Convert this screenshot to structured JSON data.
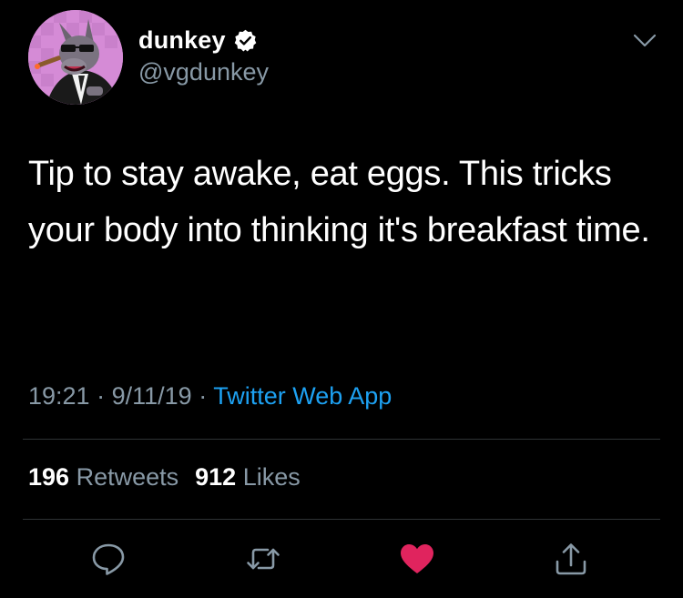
{
  "author": {
    "display_name": "dunkey",
    "handle": "@vgdunkey",
    "verified": true,
    "avatar_icon": "cartoon-avatar"
  },
  "tweet": {
    "text": "Tip to stay awake, eat eggs. This tricks your body into thinking it's breakfast time.",
    "time": "19:21",
    "date": "9/11/19",
    "separator": "·",
    "source": "Twitter Web App"
  },
  "stats": {
    "retweets_count": "196",
    "retweets_label": "Retweets",
    "likes_count": "912",
    "likes_label": "Likes"
  },
  "actions": [
    {
      "name": "reply",
      "icon": "reply-icon"
    },
    {
      "name": "retweet",
      "icon": "retweet-icon"
    },
    {
      "name": "like",
      "icon": "heart-icon",
      "active": true
    },
    {
      "name": "share",
      "icon": "share-icon"
    }
  ],
  "colors": {
    "background": "#000000",
    "text": "#ffffff",
    "secondary": "#8899a6",
    "link": "#1da1f2",
    "like": "#e0245e",
    "divider": "#2f3336",
    "avatar_bg": "#d58bd6"
  }
}
